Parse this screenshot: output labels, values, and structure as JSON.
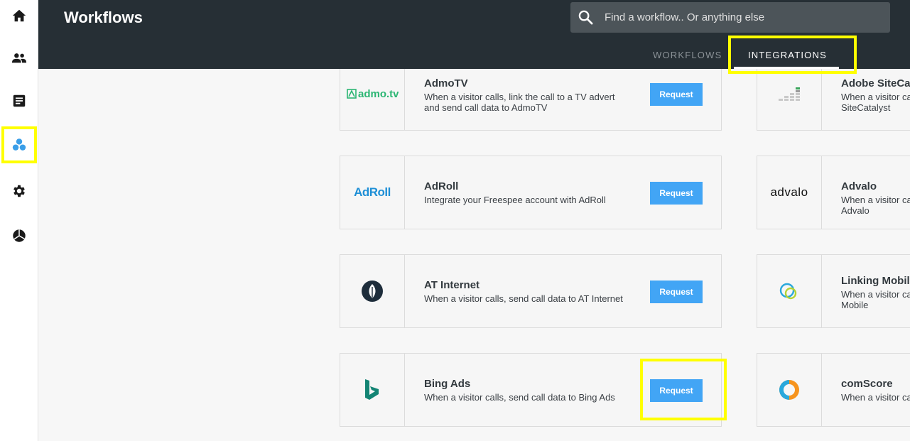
{
  "header": {
    "title": "Workflows",
    "search_placeholder": "Find a workflow.. Or anything else",
    "tabs": [
      {
        "label": "WORKFLOWS"
      },
      {
        "label": "INTEGRATIONS"
      }
    ]
  },
  "colors": {
    "header_bg": "#262f35",
    "accent": "#42a5f5",
    "highlight": "#ffff00"
  },
  "sidebar": {
    "items": [
      {
        "icon": "home-icon"
      },
      {
        "icon": "people-icon"
      },
      {
        "icon": "document-icon"
      },
      {
        "icon": "integrations-icon"
      },
      {
        "icon": "gear-icon"
      },
      {
        "icon": "pie-chart-icon"
      }
    ]
  },
  "integrations": {
    "left": [
      {
        "name": "AdmoTV",
        "description": "When a visitor calls, link the call to a TV advert and send call data to AdmoTV",
        "button": "Request",
        "logo": "admo.tv"
      },
      {
        "name": "AdRoll",
        "description": "Integrate your Freespee account with AdRoll",
        "button": "Request",
        "logo": "AdRoll"
      },
      {
        "name": "AT Internet",
        "description": "When a visitor calls, send call data to AT Internet",
        "button": "Request",
        "logo": "at-internet-icon"
      },
      {
        "name": "Bing Ads",
        "description": "When a visitor calls, send call data to Bing Ads",
        "button": "Request",
        "logo": "bing-icon"
      }
    ],
    "right": [
      {
        "name": "Adobe SiteCa",
        "description": "When a visitor ca SiteCatalyst",
        "logo": "adobe-sitecatalyst-icon"
      },
      {
        "name": "Advalo",
        "description": "When a visitor ca Advalo",
        "logo": "advalo"
      },
      {
        "name": "Linking Mobil",
        "description": "When a visitor ca Mobile",
        "logo": "linking-mobile-icon"
      },
      {
        "name": "comScore",
        "description": "When a visitor ca",
        "logo": "comscore-icon"
      }
    ]
  }
}
